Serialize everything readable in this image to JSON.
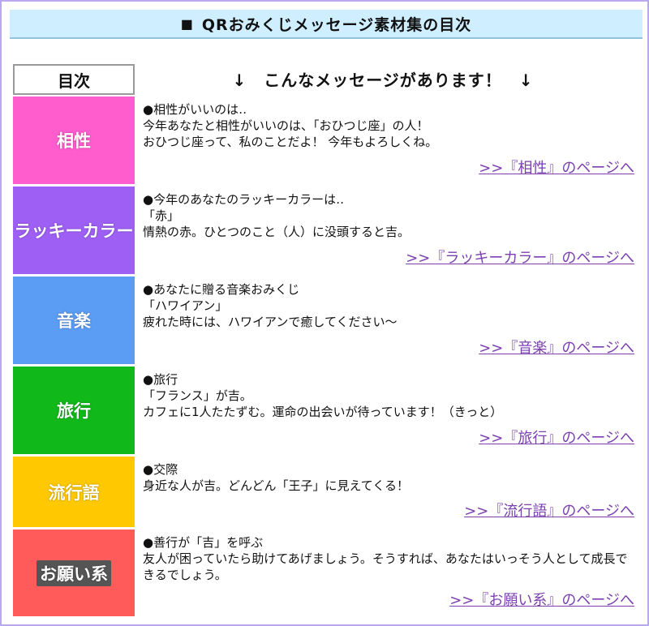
{
  "header": {
    "title": "QRおみくじメッセージ素材集の目次",
    "marker": "■"
  },
  "toc_label": "目次",
  "subtitle": "↓　こんなメッセージがあります！　↓",
  "sections": [
    {
      "category": "相性",
      "color": "#ff5ccd",
      "lines": [
        "●相性がいいのは‥",
        "今年あなたと相性がいいのは、「おひつじ座」の人！",
        "おひつじ座って、私のことだよ！ 今年もよろしくね。"
      ],
      "link": ">>『相性』のページへ"
    },
    {
      "category": "ラッキーカラー",
      "color": "#9e5ff5",
      "lines": [
        "●今年のあなたのラッキーカラーは‥",
        "「赤」",
        "情熱の赤。ひとつのこと（人）に没頭すると吉。"
      ],
      "link": ">>『ラッキーカラー』のページへ"
    },
    {
      "category": "音楽",
      "color": "#5b9cf5",
      "lines": [
        "●あなたに贈る音楽おみくじ",
        "「ハワイアン」",
        "疲れた時には、ハワイアンで癒してください～"
      ],
      "link": ">>『音楽』のページへ"
    },
    {
      "category": "旅行",
      "color": "#11b81a",
      "lines": [
        "●旅行",
        "「フランス」が吉。",
        "カフェに1人たたずむ。運命の出会いが待っています！（きっと）"
      ],
      "link": ">>『旅行』のページへ"
    },
    {
      "category": "流行語",
      "color": "#ffc800",
      "lines": [
        "●交際",
        "身近な人が吉。どんどん「王子」に見えてくる！"
      ],
      "link": ">>『流行語』のページへ"
    },
    {
      "category": "お願い系",
      "color": "#ff5b5b",
      "lines": [
        "●善行が「吉」を呼ぶ",
        "友人が困っていたら助けてあげましょう。そうすれば、あなたはいっそう人として成長できるでしょう。"
      ],
      "link": ">>『お願い系』のページへ"
    }
  ]
}
